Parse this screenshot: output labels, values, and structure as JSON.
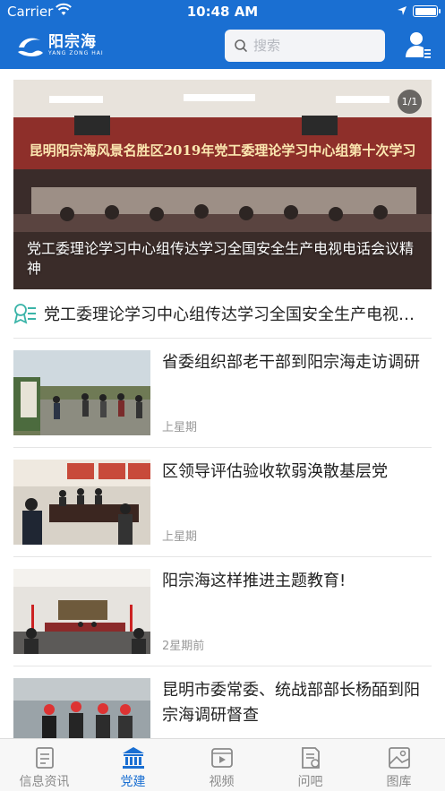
{
  "status_bar": {
    "carrier": "Carrier",
    "time": "10:48 AM"
  },
  "header": {
    "logo_cn": "阳宗海",
    "logo_en": "YANG ZONG HAI",
    "search_placeholder": "搜索"
  },
  "banner": {
    "counter": "1/1",
    "photo_text": "昆明阳宗海风景名胜区2019年党工委理论学习中心组第十次学习",
    "caption": "党工委理论学习中心组传达学习全国安全生产电视电话会议精神"
  },
  "topic": {
    "title": "党工委理论学习中心组传达学习全国安全生产电视电话会议精神"
  },
  "news": [
    {
      "title": "省委组织部老干部到阳宗海走访调研",
      "time": "上星期"
    },
    {
      "title": "区领导评估验收软弱涣散基层党",
      "time": "上星期"
    },
    {
      "title": "阳宗海这样推进主题教育!",
      "time": "2星期前"
    },
    {
      "title": "昆明市委常委、统战部部长杨皕到阳宗海调研督查",
      "time": ""
    }
  ],
  "tabbar": {
    "items": [
      {
        "label": "信息资讯"
      },
      {
        "label": "党建"
      },
      {
        "label": "视频"
      },
      {
        "label": "问吧"
      },
      {
        "label": "图库"
      }
    ],
    "active": "党建"
  },
  "colors": {
    "brand": "#1a6fd2",
    "inactive_tab": "#8a8a8a",
    "time_text": "#999999"
  }
}
